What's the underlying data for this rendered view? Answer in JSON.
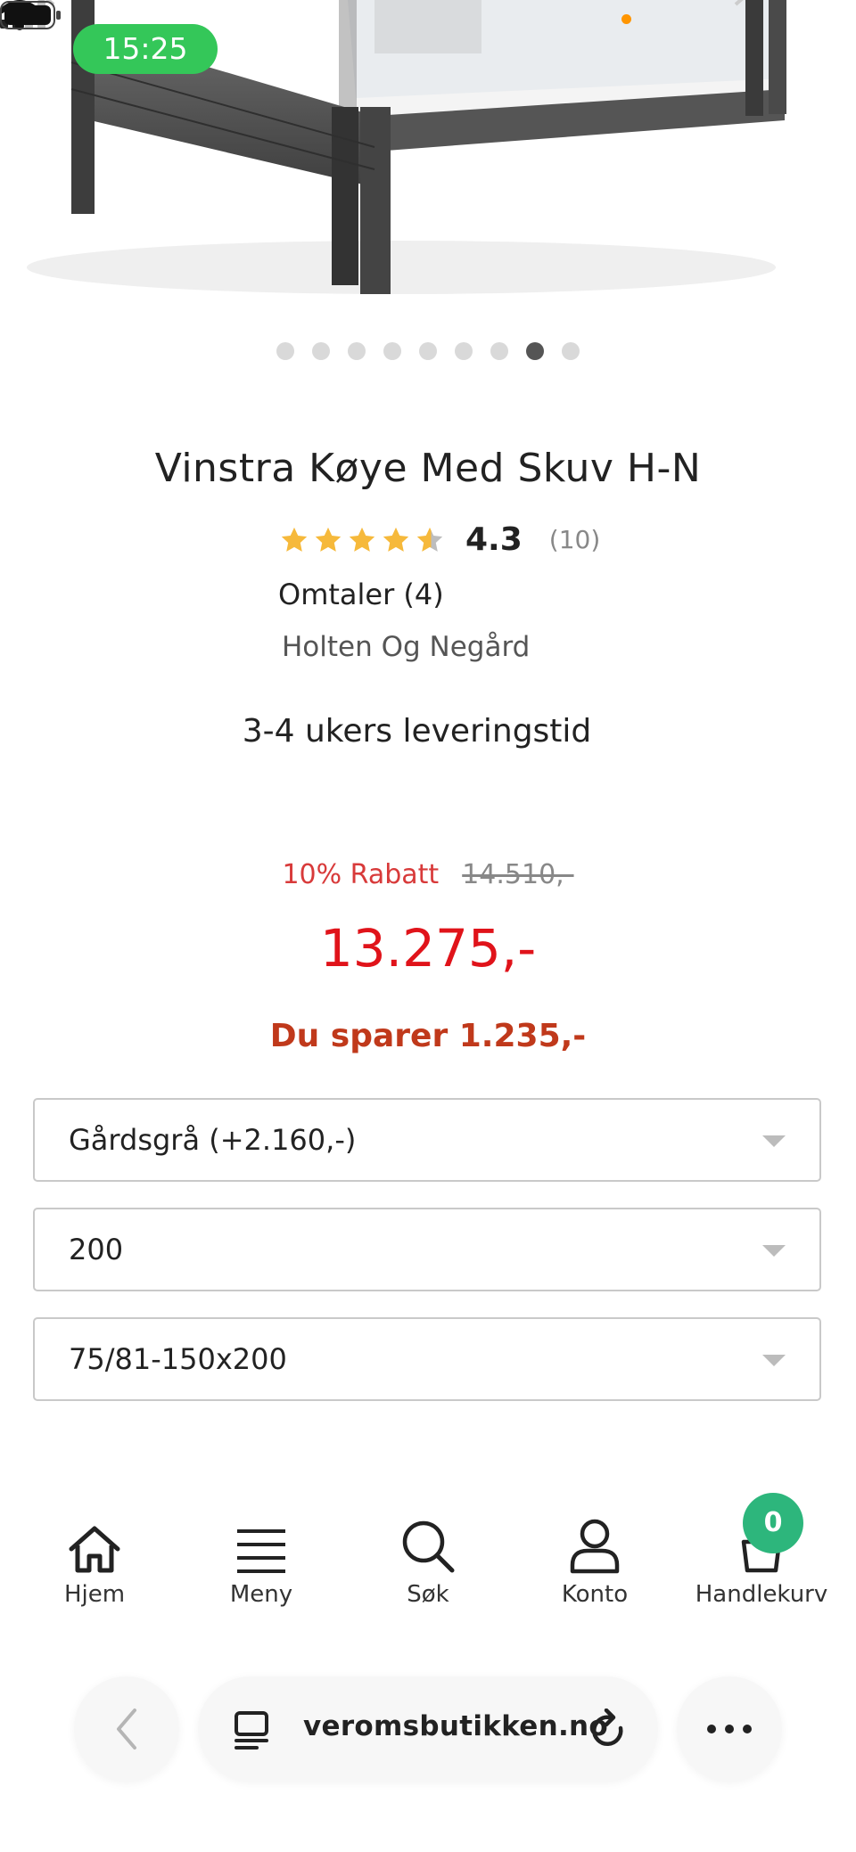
{
  "status_bar": {
    "time": "15:25",
    "icons": [
      "signal-icon",
      "wifi-icon",
      "battery-icon"
    ]
  },
  "carousel": {
    "count": 9,
    "active_index": 7
  },
  "product": {
    "title": "Vinstra Køye Med Skuv H-N",
    "rating_value": "4.3",
    "rating_stars": 4.3,
    "rating_count": "(10)",
    "reviews_label": "Omtaler (4)",
    "brand": "Holten Og Negård",
    "delivery": "3-4 ukers leveringstid",
    "discount_label": "10% Rabatt",
    "old_price": "14.510,-",
    "price": "13.275,-",
    "savings": "Du sparer 1.235,-"
  },
  "options": {
    "color": "Gårdsgrå (+2.160,-)",
    "length": "200",
    "size": "75/81-150x200"
  },
  "bottom_nav": {
    "items": [
      {
        "label": "Hjem",
        "icon": "home-icon"
      },
      {
        "label": "Meny",
        "icon": "menu-icon"
      },
      {
        "label": "Søk",
        "icon": "search-icon"
      },
      {
        "label": "Konto",
        "icon": "account-icon"
      },
      {
        "label": "Handlekurv",
        "icon": "cart-icon"
      }
    ],
    "cart_count": "0"
  },
  "browser": {
    "url": "veromsbutikken.no"
  },
  "colors": {
    "accent_green": "#2db67c",
    "price_red": "#e0131a",
    "discount_red": "#d83a3a",
    "savings_red": "#c0391b",
    "star_gold": "#f6b93b"
  }
}
